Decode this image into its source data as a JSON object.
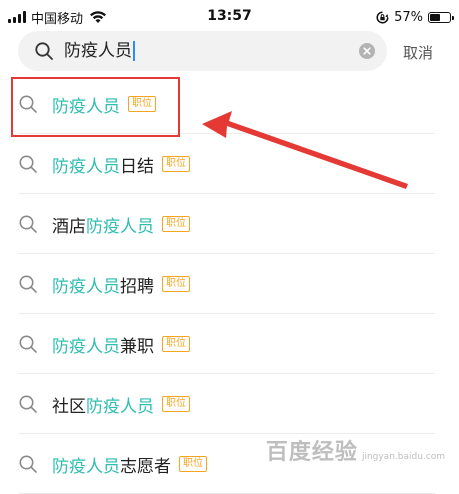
{
  "status_bar": {
    "carrier": "中国移动",
    "time": "13:57",
    "battery_percent": "57%",
    "battery_level": 0.57,
    "icons": [
      "signal-icon",
      "wifi-icon",
      "rotation-lock-icon",
      "battery-icon"
    ]
  },
  "search": {
    "query": "防疫人员",
    "cancel_label": "取消"
  },
  "suggestions": [
    {
      "parts": [
        {
          "text": "防疫人员",
          "highlight": true
        }
      ],
      "tag": "职位"
    },
    {
      "parts": [
        {
          "text": "防疫人员",
          "highlight": true
        },
        {
          "text": "日结",
          "highlight": false
        }
      ],
      "tag": "职位"
    },
    {
      "parts": [
        {
          "text": "酒店",
          "highlight": false
        },
        {
          "text": "防疫人员",
          "highlight": true
        }
      ],
      "tag": "职位"
    },
    {
      "parts": [
        {
          "text": "防疫人员",
          "highlight": true
        },
        {
          "text": "招聘",
          "highlight": false
        }
      ],
      "tag": "职位"
    },
    {
      "parts": [
        {
          "text": "防疫人员",
          "highlight": true
        },
        {
          "text": "兼职",
          "highlight": false
        }
      ],
      "tag": "职位"
    },
    {
      "parts": [
        {
          "text": "社区",
          "highlight": false
        },
        {
          "text": "防疫人员",
          "highlight": true
        }
      ],
      "tag": "职位"
    },
    {
      "parts": [
        {
          "text": "防疫人员",
          "highlight": true
        },
        {
          "text": "志愿者",
          "highlight": false
        }
      ],
      "tag": "职位"
    }
  ],
  "colors": {
    "highlight_text": "#2fbdb0",
    "tag": "#f5a524",
    "annotation": "#e53935"
  },
  "watermark": {
    "cn": "百度经验",
    "en": "jingyan.baidu.com"
  }
}
